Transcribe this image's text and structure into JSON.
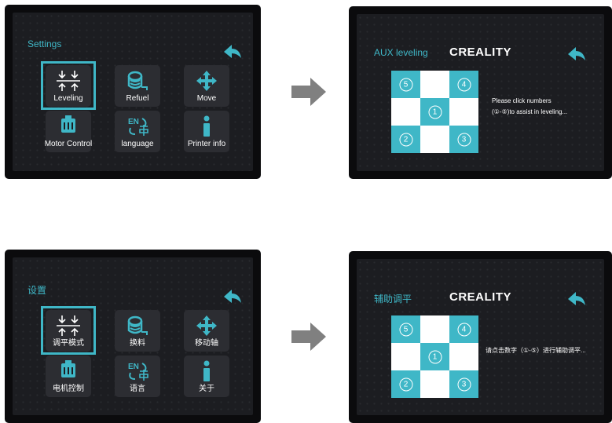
{
  "settings_en": {
    "title": "Settings",
    "tiles": [
      "Leveling",
      "Refuel",
      "Move",
      "Motor Control",
      "language",
      "Printer info"
    ]
  },
  "settings_zh": {
    "title": "设置",
    "tiles": [
      "调平模式",
      "换料",
      "移动轴",
      "电机控制",
      "语言",
      "关于"
    ]
  },
  "aux_en": {
    "title": "AUX leveling",
    "logo": "CREALITY",
    "grid": [
      "5",
      "",
      "4",
      "",
      "1",
      "",
      "2",
      "",
      "3"
    ],
    "hint_line1": "Please click numbers",
    "hint_line2": "(①-⑤)to assist in leveling..."
  },
  "aux_zh": {
    "title": "辅助调平",
    "logo": "CREALITY",
    "grid": [
      "5",
      "",
      "4",
      "",
      "1",
      "",
      "2",
      "",
      "3"
    ],
    "hint_line1": "请点击数字（①-⑤）进行辅助调平..."
  },
  "colors": {
    "accent": "#3fb7c7",
    "screen": "#1c1d21",
    "tile": "#2c2d32",
    "arrow": "#808080"
  },
  "icons": [
    "leveling-icon",
    "refuel-spool-icon",
    "move-cross-icon",
    "motor-icon",
    "language-en-icon",
    "info-icon",
    "back-arrow-icon",
    "next-arrow-icon"
  ]
}
